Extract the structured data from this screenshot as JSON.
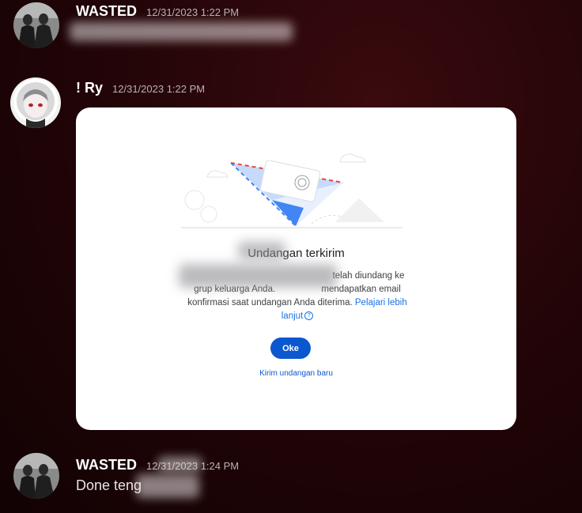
{
  "messages": [
    {
      "author": "WASTED",
      "timestamp": "12/31/2023 1:22 PM"
    },
    {
      "author": "! Ry",
      "timestamp": "12/31/2023 1:22 PM"
    },
    {
      "author": "WASTED",
      "timestamp": "12/31/2023 1:24 PM",
      "text": "Done teng"
    }
  ],
  "dialog": {
    "title": "Undangan terkirim",
    "body_line1_end": "telah diundang ke",
    "body_line2_start": "grup keluarga Anda.",
    "body_line2_end": "mendapatkan email",
    "body_line3": "konfirmasi saat undangan Anda diterima.",
    "learn_more_part1": "Pelajari lebih",
    "learn_more_part2": "lanjut",
    "help_icon_glyph": "?",
    "ok_label": "Oke",
    "send_new_invite_label": "Kirim undangan baru",
    "accent_color": "#0b57d0"
  }
}
